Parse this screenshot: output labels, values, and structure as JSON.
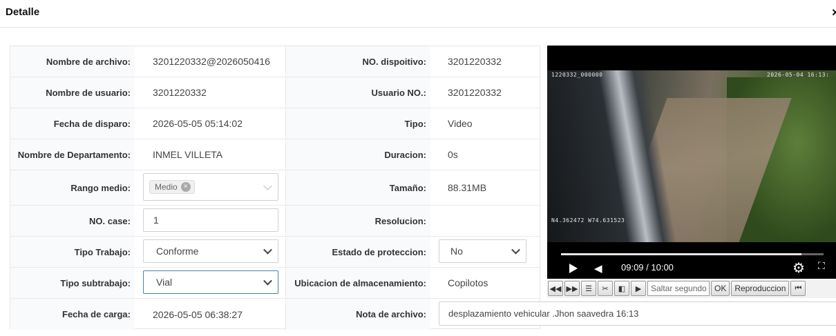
{
  "header": {
    "title": "Detalle",
    "close_label": "×"
  },
  "rows": [
    {
      "l1": "Nombre de archivo:",
      "v1": "3201220332@2026050416",
      "l2": "NO. dispoitivo:",
      "v2": "3201220332"
    },
    {
      "l1": "Nombre de usuario:",
      "v1": "3201220332",
      "l2": "Usuario NO.:",
      "v2": "3201220332"
    },
    {
      "l1": "Fecha de disparo:",
      "v1": "2026-05-05 05:14:02",
      "l2": "Tipo:",
      "v2": "Video"
    },
    {
      "l1": "Nombre de Departamento:",
      "v1": "INMEL VILLETA",
      "l2": "Duracion:",
      "v2": "0s"
    },
    {
      "l1": "Rango medio:",
      "v1": "",
      "l2": "Tamaño:",
      "v2": "88.31MB"
    },
    {
      "l1": "NO. case:",
      "v1": "",
      "l2": "Resolucion:",
      "v2": ""
    },
    {
      "l1": "Tipo Trabajo:",
      "v1": "",
      "l2": "Estado de proteccion:",
      "v2": ""
    },
    {
      "l1": "Tipo subtrabajo:",
      "v1": "",
      "l2": "Ubicacion de almacenamiento:",
      "v2": "Copilotos"
    },
    {
      "l1": "Fecha de carga:",
      "v1": "2026-05-05 06:38:27",
      "l2": "Nota de archivo:",
      "v2": ""
    }
  ],
  "rango_medio": {
    "tag": "Medio",
    "remove": "⊗"
  },
  "no_case": {
    "value": "1"
  },
  "tipo_trabajo": {
    "selected": "Conforme"
  },
  "tipo_subtrabajo": {
    "selected": "Vial"
  },
  "estado_proteccion": {
    "selected": "No"
  },
  "nota_archivo": {
    "value": "desplazamiento vehicular .Jhon saavedra 16:13"
  },
  "video": {
    "osd_device": "1220332_000000",
    "osd_datetime": "2026-05-04 16:13:",
    "osd_gps": "N4.362472 W74.631523",
    "time": "09:09 / 10:00",
    "progress_fraction": 0.915,
    "icons": {
      "play": "play-icon",
      "volume": "volume-icon",
      "settings": "gear-icon",
      "fullscreen": "fullscreen-icon"
    }
  },
  "toolbar": {
    "rewind": "◀◀",
    "forward": "▶▶",
    "list": "☰",
    "cut": "✂",
    "prev_frame": "◧",
    "next_frame": "▶",
    "skip_placeholder": "Saltar segundo",
    "ok": "OK",
    "reproduccion": "Reproduccion",
    "first": "⏮"
  },
  "colors": {
    "header_border": "#e6e6e6",
    "label_bg": "#f8fafb",
    "focus_border": "#4a7fb5"
  }
}
